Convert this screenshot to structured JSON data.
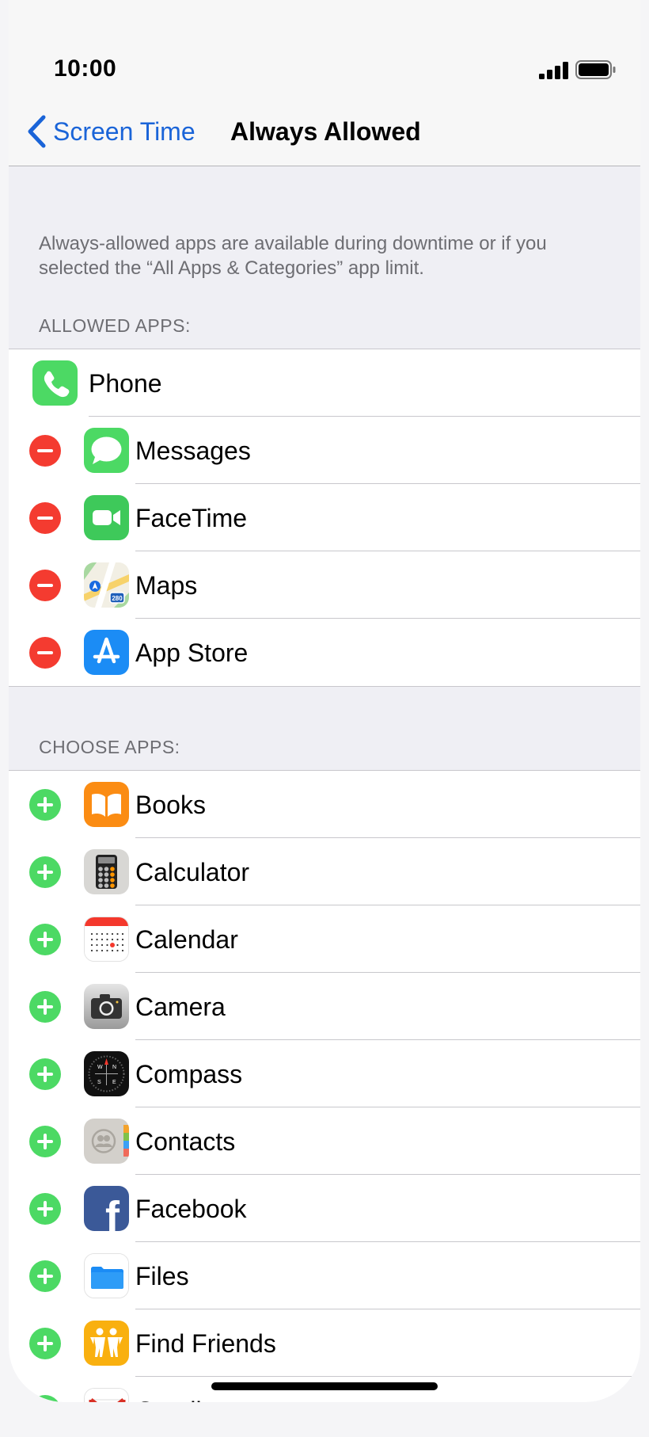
{
  "status_bar": {
    "time": "10:00"
  },
  "nav": {
    "back_label": "Screen Time",
    "title": "Always Allowed"
  },
  "description": "Always-allowed apps are available during downtime or if you selected the “All Apps & Categories” app limit.",
  "allowed_section": {
    "header": "ALLOWED APPS:",
    "items": [
      {
        "label": "Phone",
        "icon": "phone-icon",
        "control": "none"
      },
      {
        "label": "Messages",
        "icon": "messages-icon",
        "control": "remove"
      },
      {
        "label": "FaceTime",
        "icon": "facetime-icon",
        "control": "remove"
      },
      {
        "label": "Maps",
        "icon": "maps-icon",
        "control": "remove",
        "badge": "280"
      },
      {
        "label": "App Store",
        "icon": "app-store-icon",
        "control": "remove"
      }
    ]
  },
  "choose_section": {
    "header": "CHOOSE APPS:",
    "items": [
      {
        "label": "Books",
        "icon": "books-icon",
        "control": "add"
      },
      {
        "label": "Calculator",
        "icon": "calculator-icon",
        "control": "add"
      },
      {
        "label": "Calendar",
        "icon": "calendar-icon",
        "control": "add"
      },
      {
        "label": "Camera",
        "icon": "camera-icon",
        "control": "add"
      },
      {
        "label": "Compass",
        "icon": "compass-icon",
        "control": "add",
        "marks": [
          "W",
          "N",
          "S",
          "E"
        ]
      },
      {
        "label": "Contacts",
        "icon": "contacts-icon",
        "control": "add"
      },
      {
        "label": "Facebook",
        "icon": "facebook-icon",
        "control": "add",
        "glyph": "f"
      },
      {
        "label": "Files",
        "icon": "files-icon",
        "control": "add"
      },
      {
        "label": "Find Friends",
        "icon": "find-friends-icon",
        "control": "add"
      },
      {
        "label": "Gmail",
        "icon": "gmail-icon",
        "control": "add"
      }
    ]
  },
  "colors": {
    "accent_blue": "#1a64d8",
    "remove_red": "#f43b30",
    "add_green": "#4cd964",
    "group_background": "#efeff4"
  }
}
